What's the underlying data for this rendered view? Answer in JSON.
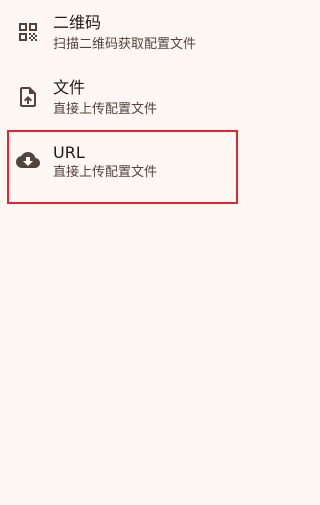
{
  "list": {
    "items": [
      {
        "title": "二维码",
        "subtitle": "扫描二维码获取配置文件",
        "icon": "qr-code-icon"
      },
      {
        "title": "文件",
        "subtitle": "直接上传配置文件",
        "icon": "file-upload-icon"
      },
      {
        "title": "URL",
        "subtitle": "直接上传配置文件",
        "icon": "cloud-download-icon"
      }
    ]
  },
  "colors": {
    "background": "#fef7f4",
    "icon": "#52443d",
    "highlight_border": "#e0262f"
  }
}
